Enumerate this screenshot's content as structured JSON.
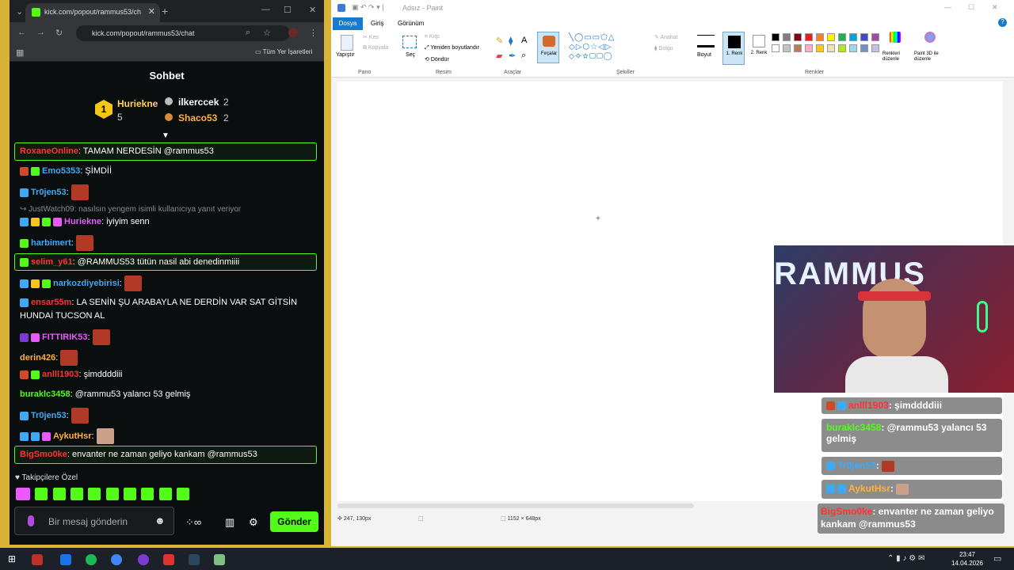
{
  "browser": {
    "tab_title": "kick.com/popout/rammus53/ch",
    "url": "kick.com/popout/rammus53/chat",
    "bookmarks_label": "Tüm Yer İşaretleri"
  },
  "chat": {
    "title": "Sohbet",
    "leaderboard": [
      {
        "rank": "1",
        "name": "Huriekne",
        "count": "5"
      },
      {
        "rank": "2",
        "name": "ilkercсek",
        "count": "2"
      },
      {
        "rank": "3",
        "name": "Shaco53",
        "count": "2"
      }
    ],
    "messages": [
      {
        "user": "RoxaneOnline",
        "text": ": TAMAM NERDESİN @rammus53",
        "color": "#ff3333"
      },
      {
        "user": "Emo5353",
        "text": ": ŞİMDİİ",
        "color": "#3fa9f5"
      },
      {
        "user": "Tr0jen53",
        "text": ":",
        "color": "#3fa9f5"
      },
      {
        "user": "JustWatch09",
        "text": ": nasılsın yengem isimli kullanıcıya yanıt veriyor",
        "color": "#888888"
      },
      {
        "user": "Huriekne",
        "text": ": iyiyim senn",
        "color": "#e85aff"
      },
      {
        "user": "harbimert",
        "text": ":",
        "color": "#3fa9f5"
      },
      {
        "user": "selim_y61",
        "text": ": @RAMMUS53 tütün nasil abi denedinmiiii",
        "color": "#ff3333"
      },
      {
        "user": "narkozdiyebirisi",
        "text": ":",
        "color": "#3fa9f5"
      },
      {
        "user": "ensar55m",
        "text": ": LA SENİN ŞU ARABAYLA NE DERDİN VAR SAT GİTSİN",
        "color": "#ff3333"
      },
      {
        "user": "",
        "text": "HUNDAİ TUCSON AL",
        "color": "#ffffff"
      },
      {
        "user": "FITTIRIK53",
        "text": ":",
        "color": "#e85aff"
      },
      {
        "user": "derin426",
        "text": ":",
        "color": "#ffb13b"
      },
      {
        "user": "anlll1903",
        "text": ": şimddddiii",
        "color": "#ff3333"
      },
      {
        "user": "buraklc3458",
        "text": ": @rammu53 yalancı 53 gelmiş",
        "color": "#53fc18"
      },
      {
        "user": "Tr0jen53",
        "text": ":",
        "color": "#3fa9f5"
      },
      {
        "user": "AykutHsr",
        "text": ":",
        "color": "#ffb13b"
      },
      {
        "user": "BigSmo0ke",
        "text": ": envanter ne zaman geliyo kankam @rammus53",
        "color": "#ff3333"
      }
    ],
    "followers_only": "Takipçilere Özel",
    "input_placeholder": "Bir mesaj gönderin",
    "send_label": "Gönder"
  },
  "paint": {
    "title": "Adsız - Paint",
    "menu": [
      "Dosya",
      "Giriş",
      "Görünüm"
    ],
    "tools": {
      "paste": "Yapıştır",
      "cut": "Kes",
      "copy": "Kopyala",
      "select": "Seç",
      "crop": "Kırp",
      "resize": "Yeniden boyutlandır",
      "rotate": "Döndür",
      "brushes": "Fırçalar",
      "outline": "Anahat",
      "fill": "Dolgu",
      "size": "Boyut",
      "color1": "1. Renk",
      "color2": "2. Renk",
      "edit_colors": "Renkleri düzenle",
      "paint3d": "Paint 3D ile düzenle"
    },
    "groups": [
      "Pano",
      "Resim",
      "Araçlar",
      "Şekiller",
      "Renkler"
    ],
    "status_pos": "247, 130px",
    "status_size": "1152 × 648px",
    "palette": [
      "#000000",
      "#7f7f7f",
      "#880015",
      "#ed1c24",
      "#ff7f27",
      "#fff200",
      "#22b14c",
      "#00a2e8",
      "#3f48cc",
      "#a349a4",
      "#ffffff",
      "#c3c3c3",
      "#b97a57",
      "#ffaec9",
      "#ffc90e",
      "#efe4b0",
      "#b5e61d",
      "#99d9ea",
      "#7092be",
      "#c8bfe7"
    ]
  },
  "overlay": {
    "messages": [
      {
        "user": "anlll1903",
        "text": ": şimddddiii"
      },
      {
        "user": "buraklc3458",
        "text": ": @rammu53 yalancı 53 gelmiş"
      },
      {
        "user": "Tr0jen53",
        "text": ":"
      },
      {
        "user": "AykutHsr",
        "text": ":"
      },
      {
        "user": "BigSmo0ke",
        "text": ": envanter ne zaman geliyo kankam @rammus53"
      }
    ]
  },
  "taskbar": {
    "time": "23:47",
    "date": "14.04.2026"
  }
}
